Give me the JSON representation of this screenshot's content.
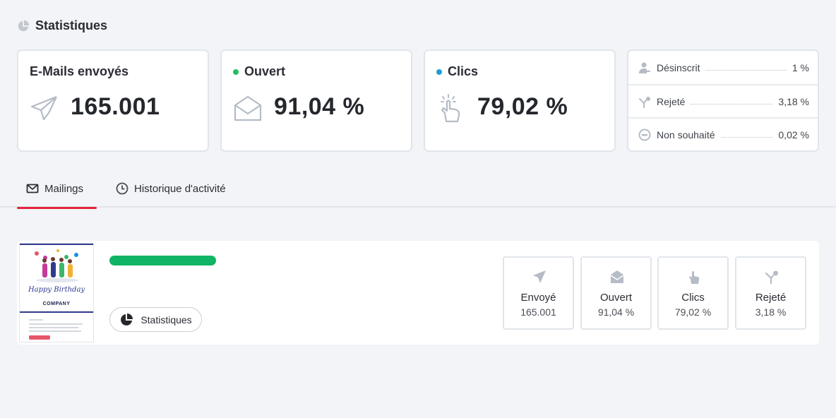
{
  "page": {
    "title": "Statistiques"
  },
  "stats": {
    "sent": {
      "label": "E-Mails envoyés",
      "value": "165.001",
      "icon": "paper-plane-icon"
    },
    "opened": {
      "label": "Ouvert",
      "value": "91,04 %",
      "dot_color": "#22c05a",
      "icon": "envelope-open-icon"
    },
    "clicks": {
      "label": "Clics",
      "value": "79,02 %",
      "dot_color": "#1a9fd8",
      "icon": "hand-pointer-icon"
    }
  },
  "side_stats": [
    {
      "label": "Désinscrit",
      "value": "1 %",
      "icon": "user-minus-icon"
    },
    {
      "label": "Rejeté",
      "value": "3,18 %",
      "icon": "bounce-icon"
    },
    {
      "label": "Non souhaité",
      "value": "0,02 %",
      "icon": "block-icon"
    }
  ],
  "tabs": [
    {
      "label": "Mailings",
      "icon": "mail-icon",
      "active": true
    },
    {
      "label": "Historique d'activité",
      "icon": "clock-icon",
      "active": false
    }
  ],
  "mailing": {
    "thumbnail": {
      "headline": "Happy Birthday",
      "brand": "COMPANY"
    },
    "progress": 100,
    "progress_color": "#0fb464",
    "stats_button_label": "Statistiques",
    "metrics": [
      {
        "label": "Envoyé",
        "value": "165.001",
        "icon": "paper-plane-icon"
      },
      {
        "label": "Ouvert",
        "value": "91,04 %",
        "icon": "envelope-icon"
      },
      {
        "label": "Clics",
        "value": "79,02 %",
        "icon": "hand-pointer-icon"
      },
      {
        "label": "Rejeté",
        "value": "3,18 %",
        "icon": "bounce-icon"
      }
    ]
  },
  "colors": {
    "accent": "#e5243b",
    "icon_gray": "#b5bcc5",
    "text": "#2a2d33"
  }
}
